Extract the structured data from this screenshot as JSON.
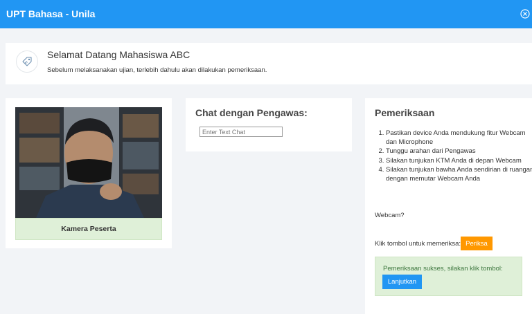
{
  "header": {
    "title": "UPT Bahasa - Unila",
    "close_icon": "close-circle-icon"
  },
  "welcome": {
    "icon": "tag-icon",
    "title": "Selamat Datang Mahasiswa ABC",
    "subtitle": "Sebelum melaksanakan ujian, terlebih dahulu akan dilakukan pemeriksaan."
  },
  "camera": {
    "label": "Kamera Peserta"
  },
  "chat": {
    "title": "Chat dengan Pengawas:",
    "placeholder": "Enter Text Chat"
  },
  "check": {
    "title": "Pemeriksaan",
    "steps": [
      "Pastikan device Anda mendukung fitur Webcam dan Microphone",
      "Tunggu arahan dari Pengawas",
      "Silakan tunjukan KTM Anda di depan Webcam",
      "Silakan tunjukan bawha Anda sendirian di ruangan dengan memutar Webcam Anda"
    ],
    "webcam_question": "Webcam?",
    "klik_label": "Klik tombol untuk memeriksa:",
    "periksa_button": "Periksa",
    "success_message": "Pemeriksaan sukses, silakan klik tombol:",
    "lanjutkan_button": "Lanjutkan"
  },
  "colors": {
    "primary": "#2196f3",
    "warning": "#ff9800",
    "success_bg": "#dff0d8"
  }
}
